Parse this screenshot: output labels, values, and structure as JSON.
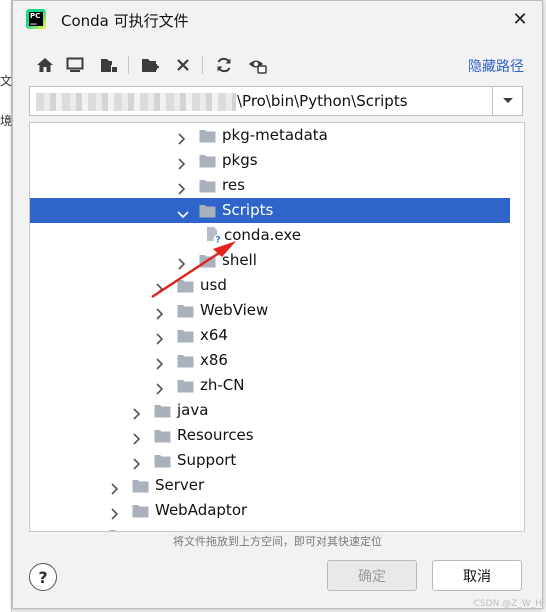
{
  "background_window": {
    "text_1": "文",
    "text_2": "境"
  },
  "dialog": {
    "title": "Conda 可执行文件",
    "close_glyph": "✕",
    "hide_path_label": "隐藏路径"
  },
  "path": {
    "visible_text": "\\Pro\\bin\\Python\\Scripts"
  },
  "tree": {
    "rows": [
      {
        "label": "pkg-metadata"
      },
      {
        "label": "pkgs"
      },
      {
        "label": "res"
      },
      {
        "label": "Scripts"
      },
      {
        "label": "conda.exe"
      },
      {
        "label": "shell"
      },
      {
        "label": "usd"
      },
      {
        "label": "WebView"
      },
      {
        "label": "x64"
      },
      {
        "label": "x86"
      },
      {
        "label": "zh-CN"
      },
      {
        "label": "java"
      },
      {
        "label": "Resources"
      },
      {
        "label": "Support"
      },
      {
        "label": "Server"
      },
      {
        "label": "WebAdaptor"
      },
      {
        "label": "..."
      }
    ]
  },
  "hint_text": "将文件拖放到上方空间，即可对其快速定位",
  "buttons": {
    "help": "?",
    "ok": "确定",
    "cancel": "取消"
  },
  "watermark": "CSDN @Z_W_H",
  "colors": {
    "selection": "#2f65ca",
    "link": "#2f65ca",
    "folder": "#a9b1bd",
    "arrow": "#e0231c"
  }
}
